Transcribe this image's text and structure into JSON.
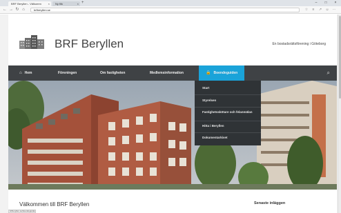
{
  "browser": {
    "tabs": [
      {
        "title": "BRF Beryllen - Välkomm",
        "active": true
      },
      {
        "title": "Ny flik",
        "active": false
      }
    ],
    "url": "brfberyllen.se",
    "new_tab_icon": "plus-icon",
    "window_controls": [
      "minimize-icon",
      "maximize-icon",
      "close-icon"
    ]
  },
  "header": {
    "site_title": "BRF Beryllen",
    "tagline": "En bostadsrättsförening i Göteborg",
    "logo_icon": "building-logo"
  },
  "nav": {
    "items": [
      {
        "label": "Hem",
        "icon": "home-icon"
      },
      {
        "label": "Föreningen"
      },
      {
        "label": "Om fastigheten"
      },
      {
        "label": "Medlemsinformation"
      },
      {
        "label": "Boendeguiden",
        "icon": "lock-icon",
        "active": true
      }
    ],
    "search_icon": "search-icon"
  },
  "dropdown": {
    "items": [
      "Start",
      "Styrelsen",
      "Fastighetsskötare och felanmälan",
      "Hitta i Beryllen",
      "Dokumentarkivet"
    ]
  },
  "content": {
    "welcome_title": "Välkommen till BRF Beryllen",
    "recent_posts_title": "Senaste inläggen"
  },
  "status_bar": {
    "text": "brfberyllen.se/boendeguiden/"
  },
  "colors": {
    "nav_bg": "#3f4245",
    "nav_active": "#1aa3d9",
    "dropdown_bg": "#2f3336"
  }
}
